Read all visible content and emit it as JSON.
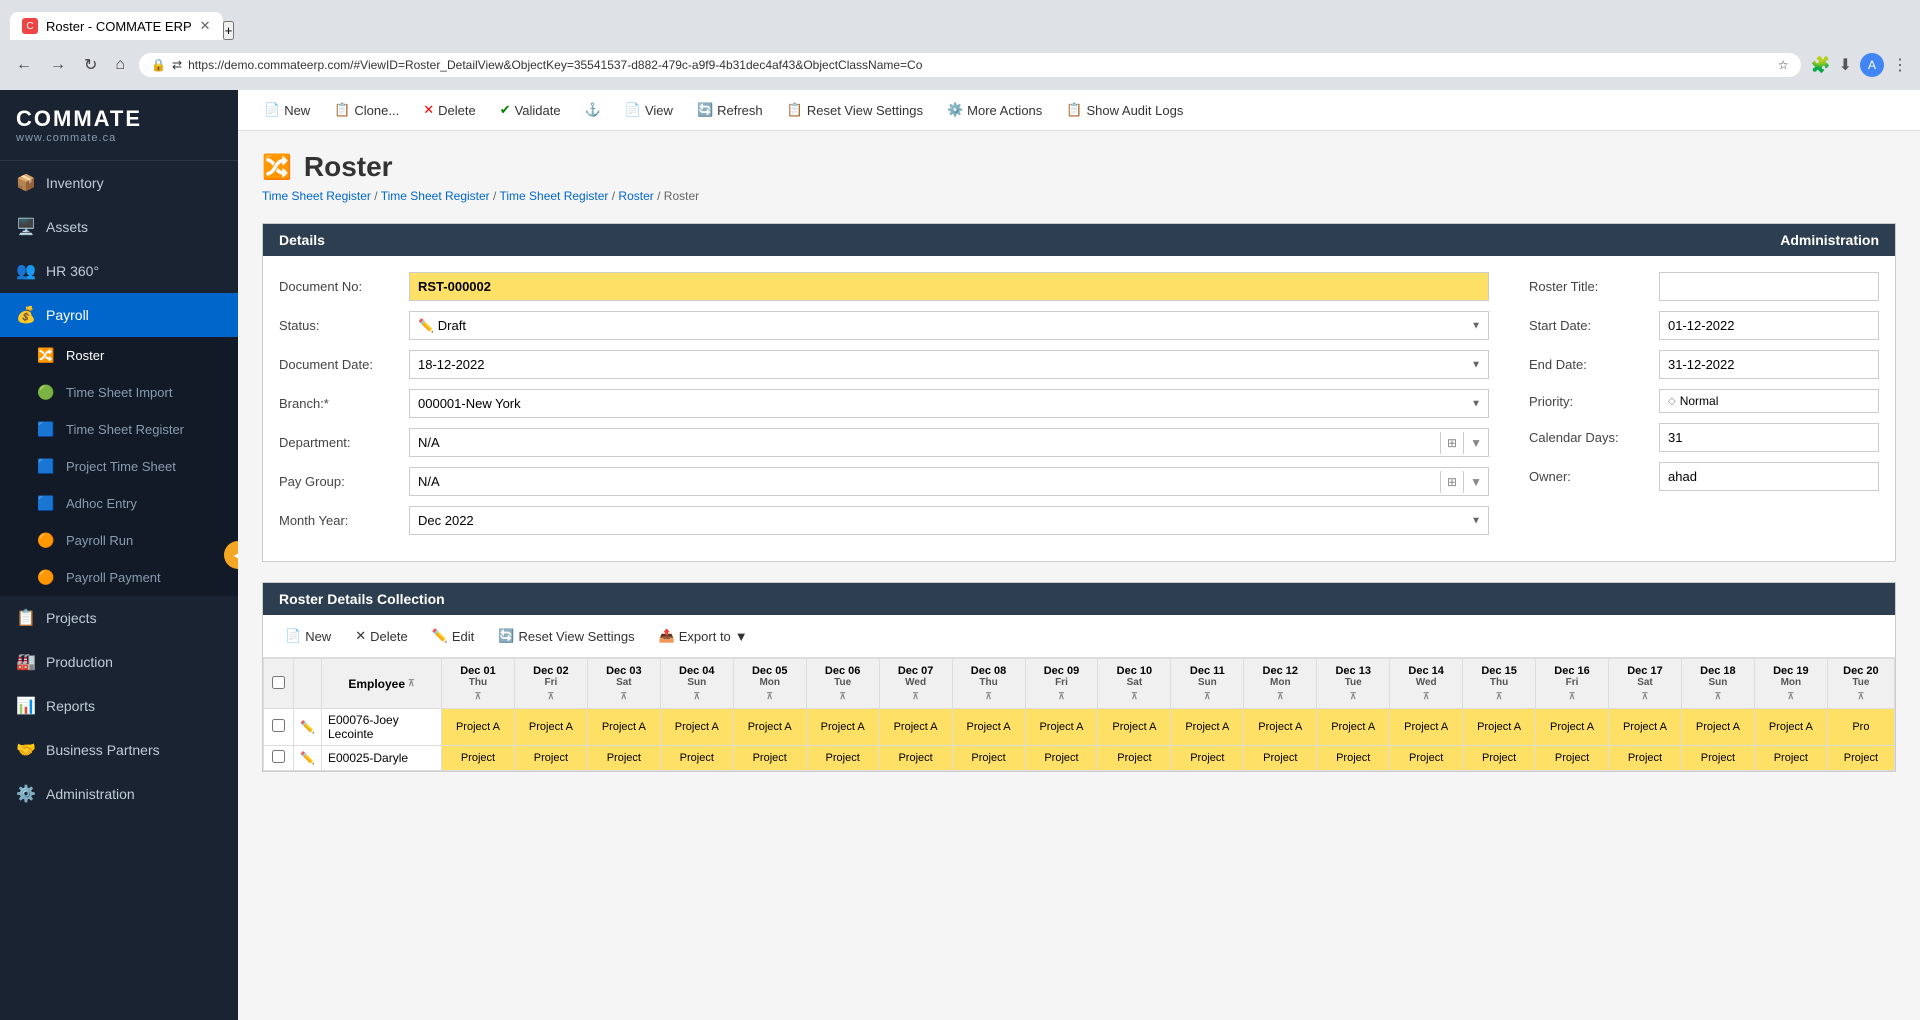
{
  "browser": {
    "tab_title": "Roster - COMMATE ERP",
    "url": "https://demo.commateerp.com/#ViewID=Roster_DetailView&ObjectKey=35541537-d882-479c-a9f9-4b31dec4af43&ObjectClassName=Co"
  },
  "toolbar": {
    "new_label": "New",
    "clone_label": "Clone...",
    "delete_label": "Delete",
    "validate_label": "Validate",
    "view_label": "View",
    "refresh_label": "Refresh",
    "reset_view_label": "Reset View Settings",
    "more_actions_label": "More Actions",
    "audit_logs_label": "Show Audit Logs"
  },
  "breadcrumb": {
    "items": [
      "Time Sheet Register",
      "Time Sheet Register",
      "Time Sheet Register",
      "Roster",
      "Roster"
    ]
  },
  "page": {
    "title": "Roster",
    "icon": "🔀"
  },
  "sidebar": {
    "logo_text": "COMMATE",
    "logo_sub": "www.commate.ca",
    "items": [
      {
        "label": "Inventory",
        "icon": "📦",
        "id": "inventory"
      },
      {
        "label": "Assets",
        "icon": "🖥️",
        "id": "assets"
      },
      {
        "label": "HR 360°",
        "icon": "👥",
        "id": "hr360"
      },
      {
        "label": "Payroll",
        "icon": "💰",
        "id": "payroll",
        "active": true,
        "expanded": true
      },
      {
        "label": "Projects",
        "icon": "📋",
        "id": "projects"
      },
      {
        "label": "Production",
        "icon": "🏭",
        "id": "production"
      },
      {
        "label": "Reports",
        "icon": "📊",
        "id": "reports"
      },
      {
        "label": "Business Partners",
        "icon": "🤝",
        "id": "business-partners"
      },
      {
        "label": "Administration",
        "icon": "⚙️",
        "id": "administration"
      }
    ],
    "payroll_sub": [
      {
        "label": "Roster",
        "icon": "🔀",
        "id": "roster",
        "active": true
      },
      {
        "label": "Time Sheet Import",
        "icon": "🟢",
        "id": "timesheet-import"
      },
      {
        "label": "Time Sheet Register",
        "icon": "🟦",
        "id": "timesheet-register"
      },
      {
        "label": "Project Time Sheet",
        "icon": "🟦",
        "id": "project-timesheet"
      },
      {
        "label": "Adhoc Entry",
        "icon": "🟦",
        "id": "adhoc-entry"
      },
      {
        "label": "Payroll Run",
        "icon": "🟠",
        "id": "payroll-run"
      },
      {
        "label": "Payroll Payment",
        "icon": "🟠",
        "id": "payroll-payment"
      }
    ]
  },
  "details_tab": "Details",
  "admin_tab": "Administration",
  "form": {
    "left": {
      "doc_no_label": "Document No:",
      "doc_no_value": "RST-000002",
      "status_label": "Status:",
      "status_value": "Draft",
      "doc_date_label": "Document Date:",
      "doc_date_value": "18-12-2022",
      "branch_label": "Branch:*",
      "branch_value": "000001-New York",
      "department_label": "Department:",
      "department_value": "N/A",
      "pay_group_label": "Pay Group:",
      "pay_group_value": "N/A",
      "month_year_label": "Month Year:",
      "month_year_value": "Dec 2022"
    },
    "right": {
      "roster_title_label": "Roster Title:",
      "roster_title_value": "",
      "start_date_label": "Start Date:",
      "start_date_value": "01-12-2022",
      "end_date_label": "End Date:",
      "end_date_value": "31-12-2022",
      "priority_label": "Priority:",
      "priority_value": "Normal",
      "calendar_days_label": "Calendar Days:",
      "calendar_days_value": "31",
      "owner_label": "Owner:",
      "owner_value": "ahad"
    }
  },
  "collection": {
    "title": "Roster Details Collection",
    "new_label": "New",
    "delete_label": "Delete",
    "edit_label": "Edit",
    "reset_label": "Reset View Settings",
    "export_label": "Export to",
    "columns": {
      "employee": "Employee",
      "days": [
        {
          "date": "Dec 01",
          "day": "Thu"
        },
        {
          "date": "Dec 02",
          "day": "Fri"
        },
        {
          "date": "Dec 03",
          "day": "Sat"
        },
        {
          "date": "Dec 04",
          "day": "Sun"
        },
        {
          "date": "Dec 05",
          "day": "Mon"
        },
        {
          "date": "Dec 06",
          "day": "Tue"
        },
        {
          "date": "Dec 07",
          "day": "Wed"
        },
        {
          "date": "Dec 08",
          "day": "Thu"
        },
        {
          "date": "Dec 09",
          "day": "Fri"
        },
        {
          "date": "Dec 10",
          "day": "Sat"
        },
        {
          "date": "Dec 11",
          "day": "Sun"
        },
        {
          "date": "Dec 12",
          "day": "Mon"
        },
        {
          "date": "Dec 13",
          "day": "Tue"
        },
        {
          "date": "Dec 14",
          "day": "Wed"
        },
        {
          "date": "Dec 15",
          "day": "Thu"
        },
        {
          "date": "Dec 16",
          "day": "Fri"
        },
        {
          "date": "Dec 17",
          "day": "Sat"
        },
        {
          "date": "Dec 18",
          "day": "Sun"
        },
        {
          "date": "Dec 19",
          "day": "Mon"
        },
        {
          "date": "Dec 20",
          "day": "Tue"
        }
      ]
    },
    "rows": [
      {
        "employee": "E00076-Joey Lecointe",
        "values": [
          "Project A",
          "Project A",
          "Project A",
          "Project A",
          "Project A",
          "Project A",
          "Project A",
          "Project A",
          "Project A",
          "Project A",
          "Project A",
          "Project A",
          "Project A",
          "Project A",
          "Project A",
          "Project A",
          "Project A",
          "Project A",
          "Project A",
          "Pro"
        ]
      },
      {
        "employee": "E00025-Daryle",
        "values": [
          "Project",
          "Project",
          "Project",
          "Project",
          "Project",
          "Project",
          "Project",
          "Project",
          "Project",
          "Project",
          "Project",
          "Project",
          "Project",
          "Project",
          "Project",
          "Project",
          "Project",
          "Project",
          "Project",
          "Project"
        ]
      }
    ]
  }
}
